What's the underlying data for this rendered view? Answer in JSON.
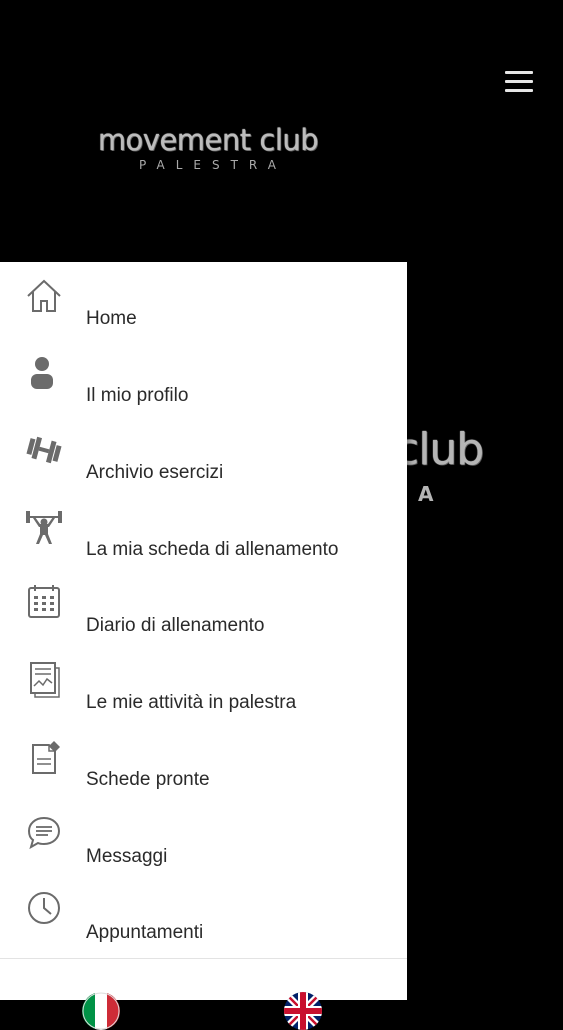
{
  "header": {
    "menu_icon": "hamburger-menu-icon",
    "logo_main": "movement club",
    "logo_sub": "PALESTRA"
  },
  "background_logo": {
    "main": "club",
    "sub": "A"
  },
  "drawer": {
    "items": [
      {
        "label": "Home",
        "icon": "home-icon"
      },
      {
        "label": "Il mio profilo",
        "icon": "user-icon"
      },
      {
        "label": "Archivio esercizi",
        "icon": "dumbbell-icon"
      },
      {
        "label": "La mia scheda di allenamento",
        "icon": "weightlifter-icon"
      },
      {
        "label": "Diario di allenamento",
        "icon": "calendar-icon"
      },
      {
        "label": "Le mie attività in palestra",
        "icon": "activity-report-icon"
      },
      {
        "label": "Schede pronte",
        "icon": "document-edit-icon"
      },
      {
        "label": "Messaggi",
        "icon": "message-icon"
      },
      {
        "label": "Appuntamenti",
        "icon": "clock-icon"
      }
    ],
    "flags": [
      {
        "icon": "italian-flag-icon"
      },
      {
        "icon": "uk-flag-icon"
      }
    ]
  },
  "colors": {
    "header_bg": "#000000",
    "drawer_bg": "#ffffff",
    "icon_gray": "#6b6b6b",
    "text_dark": "#2a2a2a"
  }
}
